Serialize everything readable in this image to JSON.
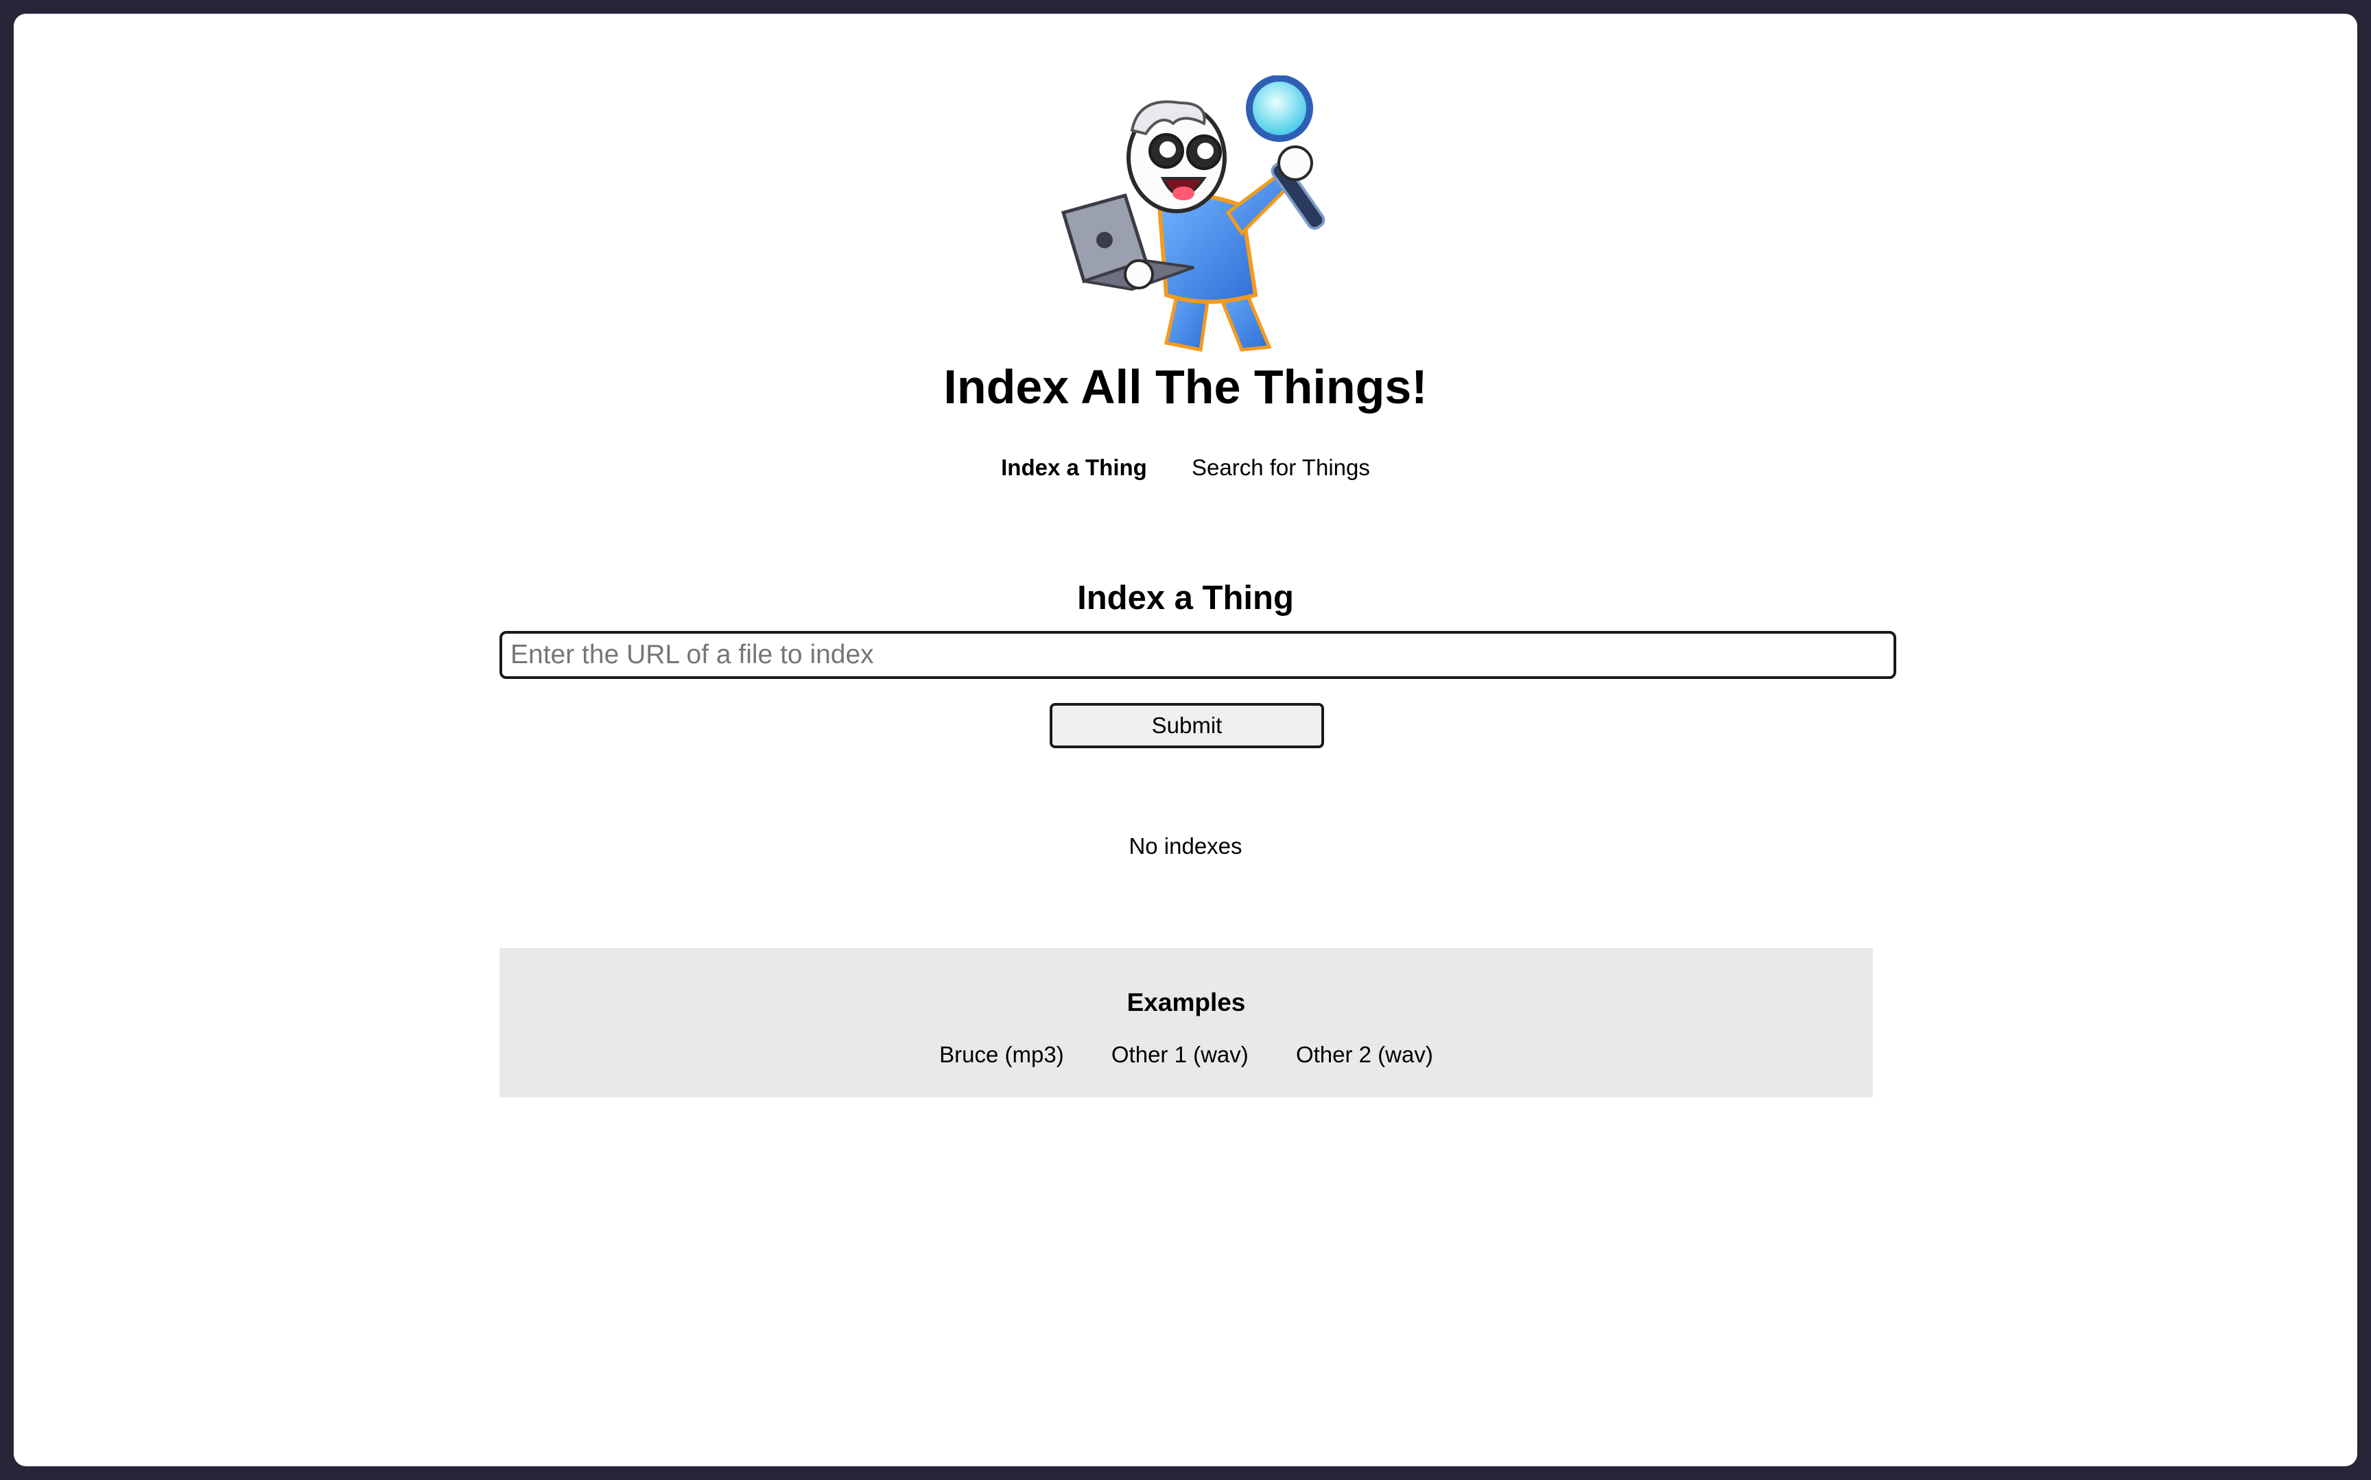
{
  "app": {
    "title": "Index All The Things!",
    "logo_icon": "mascot-with-magnifying-glass-and-laptop-icon"
  },
  "nav": {
    "items": [
      {
        "label": "Index a Thing",
        "active": true
      },
      {
        "label": "Search for Things",
        "active": false
      }
    ]
  },
  "index_form": {
    "heading": "Index a Thing",
    "url_input": {
      "value": "",
      "placeholder": "Enter the URL of a file to index"
    },
    "submit_label": "Submit"
  },
  "status": {
    "text": "No indexes"
  },
  "examples": {
    "title": "Examples",
    "items": [
      {
        "label": "Bruce (mp3)"
      },
      {
        "label": "Other 1 (wav)"
      },
      {
        "label": "Other 2 (wav)"
      }
    ]
  },
  "colors": {
    "window_frame": "#2a2438",
    "background": "#ffffff",
    "examples_panel": "#e9e9e9",
    "text": "#000000"
  }
}
